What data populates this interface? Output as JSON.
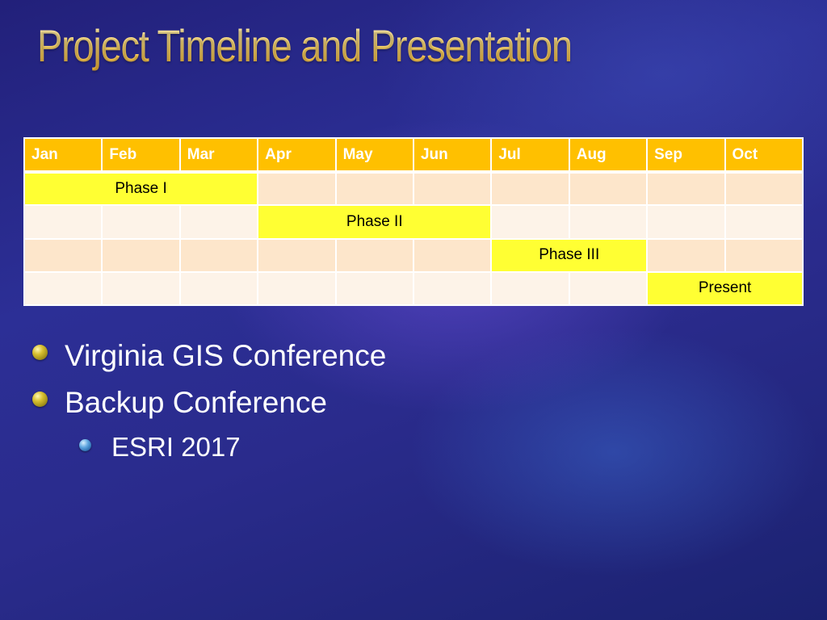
{
  "slide": {
    "title": "Project Timeline and Presentation"
  },
  "timeline": {
    "months": [
      "Jan",
      "Feb",
      "Mar",
      "Apr",
      "May",
      "Jun",
      "Jul",
      "Aug",
      "Sep",
      "Oct"
    ],
    "phases": [
      {
        "label": "Phase I",
        "start_month": "Jan",
        "end_month": "Mar"
      },
      {
        "label": "Phase II",
        "start_month": "Apr",
        "end_month": "Jun"
      },
      {
        "label": "Phase III",
        "start_month": "Jul",
        "end_month": "Aug"
      },
      {
        "label": "Present",
        "start_month": "Sep",
        "end_month": "Oct"
      }
    ],
    "colors": {
      "header": "#ffc000",
      "phase_bar": "#ffff33",
      "row_shade_a": "#fde6cb",
      "row_shade_b": "#fdf3e8"
    }
  },
  "bullets": [
    {
      "level": 1,
      "text": "Virginia GIS Conference",
      "icon": "gold-bullet-icon"
    },
    {
      "level": 1,
      "text": "Backup Conference",
      "icon": "gold-bullet-icon"
    },
    {
      "level": 2,
      "text": "ESRI 2017",
      "icon": "blue-bullet-icon"
    }
  ]
}
